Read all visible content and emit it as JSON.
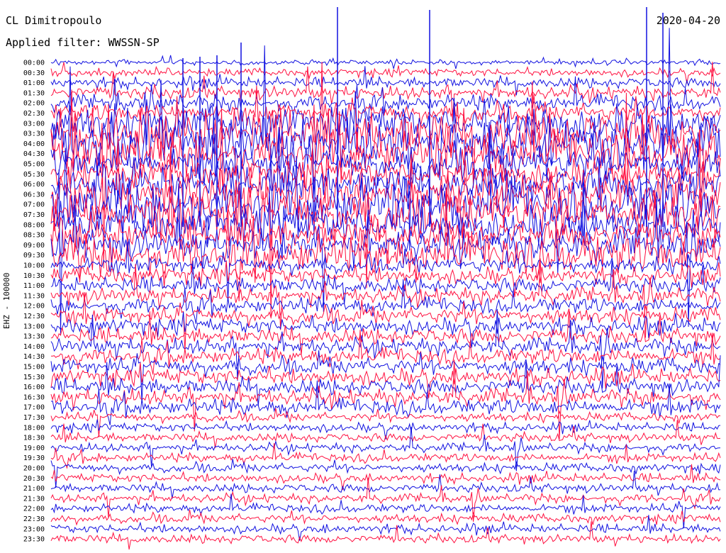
{
  "header": {
    "station": "CL Dimitropoulo",
    "filter": "Applied filter: WWSSN-SP",
    "date": "2020-04-20"
  },
  "chart_data": {
    "type": "line",
    "title": "CL Dimitropoulo",
    "subtitle": "Applied filter: WWSSN-SP",
    "ylabel": "EHZ - 100000",
    "date": "2020-04-20",
    "row_labels": [
      "00:00",
      "00:30",
      "01:00",
      "01:30",
      "02:00",
      "02:30",
      "03:00",
      "03:30",
      "04:00",
      "04:30",
      "05:00",
      "05:30",
      "06:00",
      "06:30",
      "07:00",
      "07:30",
      "08:00",
      "08:30",
      "09:00",
      "09:30",
      "10:00",
      "10:30",
      "11:00",
      "11:30",
      "12:00",
      "12:30",
      "13:00",
      "13:30",
      "14:00",
      "14:30",
      "15:00",
      "15:30",
      "16:00",
      "16:30",
      "17:00",
      "17:30",
      "18:00",
      "18:30",
      "19:00",
      "19:30",
      "20:00",
      "20:30",
      "21:00",
      "21:30",
      "22:00",
      "22:30",
      "23:00",
      "23:30"
    ],
    "colors": {
      "odd_rows": "#1010e0",
      "even_rows": "#ff1040"
    },
    "grid": false
  }
}
